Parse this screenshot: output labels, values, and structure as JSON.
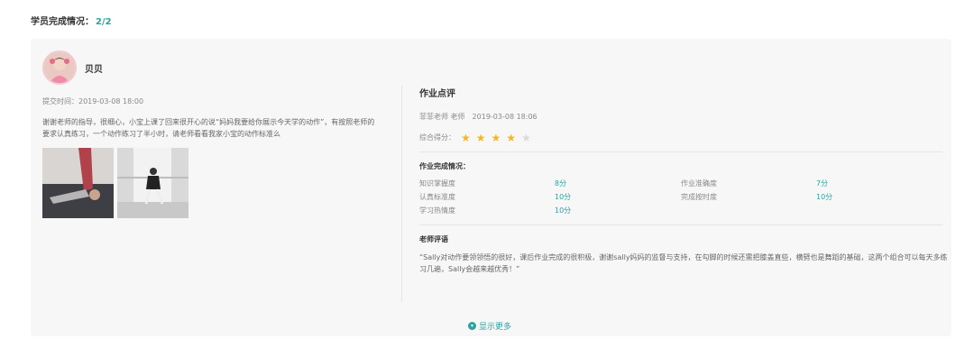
{
  "completion": {
    "label": "学员完成情况：",
    "count": "2/2"
  },
  "student": {
    "name": "贝贝",
    "submit_time": "提交时间：2019-03-08 18:00",
    "text": "谢谢老师的指导，很细心，小宝上课了回来很开心的说“妈妈我要给你展示今天学的动作”，有按照老师的要求认真练习，一个动作练习了半小时，请老师看看我家小宝的动作标准么"
  },
  "review": {
    "title": "作业点评",
    "teacher": "菲菲老师 老师",
    "time": "2019-03-08 18:06",
    "score_label": "综合得分：",
    "score_stars": 4,
    "score_max": 5,
    "completion_title": "作业完成情况：",
    "items": [
      {
        "label": "知识掌握度",
        "value": "8分"
      },
      {
        "label": "作业准确度",
        "value": "7分"
      },
      {
        "label": "认真标准度",
        "value": "10分"
      },
      {
        "label": "完成按时度",
        "value": "10分"
      },
      {
        "label": "学习热情度",
        "value": "10分"
      }
    ],
    "comment_title": "老师评语",
    "comment": "“Sally对动作要领领悟的很好，课后作业完成的很积极，谢谢sally妈妈的监督与支持，在勾脚的时候还需把膝盖直些，横劈也是舞蹈的基础，这两个组合可以每天多练习几遍，Sally会越来越优秀！”"
  },
  "show_more": "显示更多",
  "colors": {
    "accent": "#2aa3a0",
    "star": "#f5b71a",
    "card_bg": "#f7f7f7"
  }
}
